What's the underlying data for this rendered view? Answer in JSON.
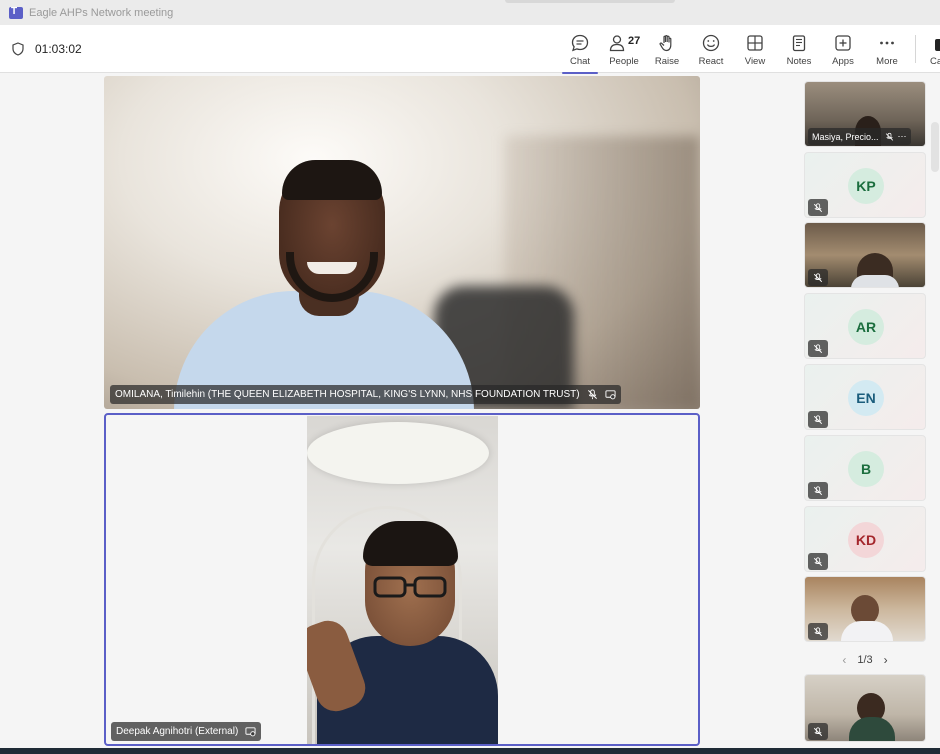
{
  "window": {
    "title": "Eagle AHPs Network meeting"
  },
  "meeting": {
    "elapsed": "01:03:02"
  },
  "toolbar": {
    "buttons": [
      {
        "label": "Chat",
        "icon": "chat-icon"
      },
      {
        "label": "People",
        "icon": "people-icon",
        "count": "27"
      },
      {
        "label": "Raise",
        "icon": "raise-hand-icon"
      },
      {
        "label": "React",
        "icon": "react-icon"
      },
      {
        "label": "View",
        "icon": "view-icon"
      },
      {
        "label": "Notes",
        "icon": "notes-icon"
      },
      {
        "label": "Apps",
        "icon": "apps-icon"
      },
      {
        "label": "More",
        "icon": "more-icon"
      },
      {
        "label": "Ca",
        "icon": "camera-icon"
      }
    ]
  },
  "stage": {
    "main_speaker": {
      "name": "OMILANA, Timilehin (THE QUEEN ELIZABETH HOSPITAL, KING'S LYNN, NHS FOUNDATION TRUST)"
    },
    "second_speaker": {
      "name": "Deepak Agnihotri (External)"
    }
  },
  "roster": {
    "tiles": [
      {
        "type": "video",
        "name": "Masiya, Precio..."
      },
      {
        "type": "avatar",
        "initials": "KP",
        "color": "#1b6e3e",
        "bg": "#d5ecdf"
      },
      {
        "type": "video",
        "name": ""
      },
      {
        "type": "avatar",
        "initials": "AR",
        "color": "#1b6e3e",
        "bg": "#d5ecdf"
      },
      {
        "type": "avatar",
        "initials": "EN",
        "color": "#1a5d7c",
        "bg": "#d3eaf2"
      },
      {
        "type": "avatar",
        "initials": "B",
        "color": "#1b6e3e",
        "bg": "#d5ecdf"
      },
      {
        "type": "avatar",
        "initials": "KD",
        "color": "#a4262c",
        "bg": "#f3d6d8"
      },
      {
        "type": "video",
        "name": ""
      },
      {
        "type": "video",
        "name": ""
      }
    ],
    "pager": {
      "current": "1/3"
    }
  },
  "colors": {
    "accent": "#5b5fc7"
  }
}
